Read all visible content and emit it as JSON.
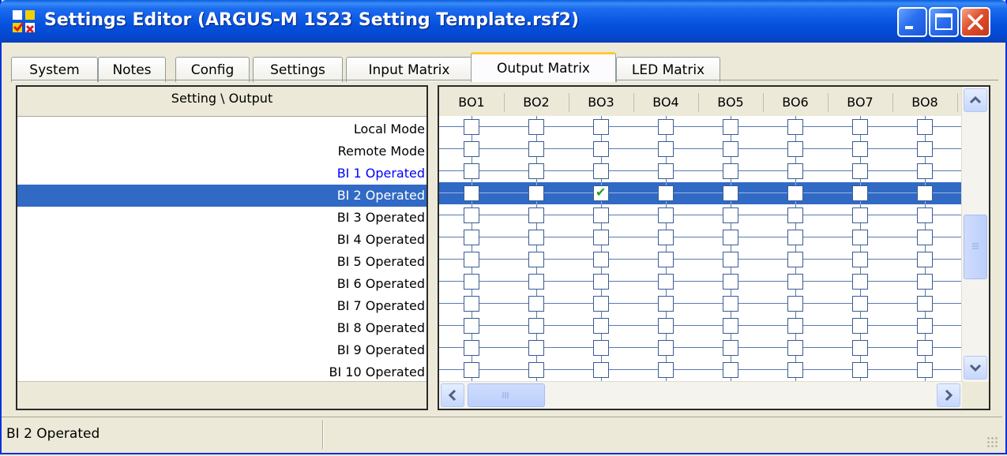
{
  "window": {
    "title": "Settings Editor (ARGUS-M 1S23 Setting Template.rsf2)"
  },
  "tabs": [
    {
      "label": "System"
    },
    {
      "label": "Notes"
    },
    {
      "label": "Config"
    },
    {
      "label": "Settings"
    },
    {
      "label": "Input Matrix"
    },
    {
      "label": "Output Matrix",
      "active": true
    },
    {
      "label": "LED Matrix"
    }
  ],
  "left": {
    "header": "Setting \\ Output",
    "rows": [
      {
        "label": "Local Mode"
      },
      {
        "label": "Remote Mode"
      },
      {
        "label": "BI 1 Operated",
        "color": "#0000ff"
      },
      {
        "label": "BI 2 Operated",
        "selected": true
      },
      {
        "label": "BI 3 Operated"
      },
      {
        "label": "BI 4 Operated"
      },
      {
        "label": "BI 5 Operated"
      },
      {
        "label": "BI 6 Operated"
      },
      {
        "label": "BI 7 Operated"
      },
      {
        "label": "BI 8 Operated"
      },
      {
        "label": "BI 9 Operated"
      },
      {
        "label": "BI 10 Operated"
      }
    ]
  },
  "matrix": {
    "columns": [
      "BO1",
      "BO2",
      "BO3",
      "BO4",
      "BO5",
      "BO6",
      "BO7",
      "BO8"
    ],
    "checked": [
      {
        "row": 3,
        "col": 2
      }
    ]
  },
  "colors": {
    "selection": "#316ac5",
    "link_blue": "#0000ff",
    "check_green": "#21a121"
  },
  "status": {
    "text": "BI 2 Operated"
  }
}
